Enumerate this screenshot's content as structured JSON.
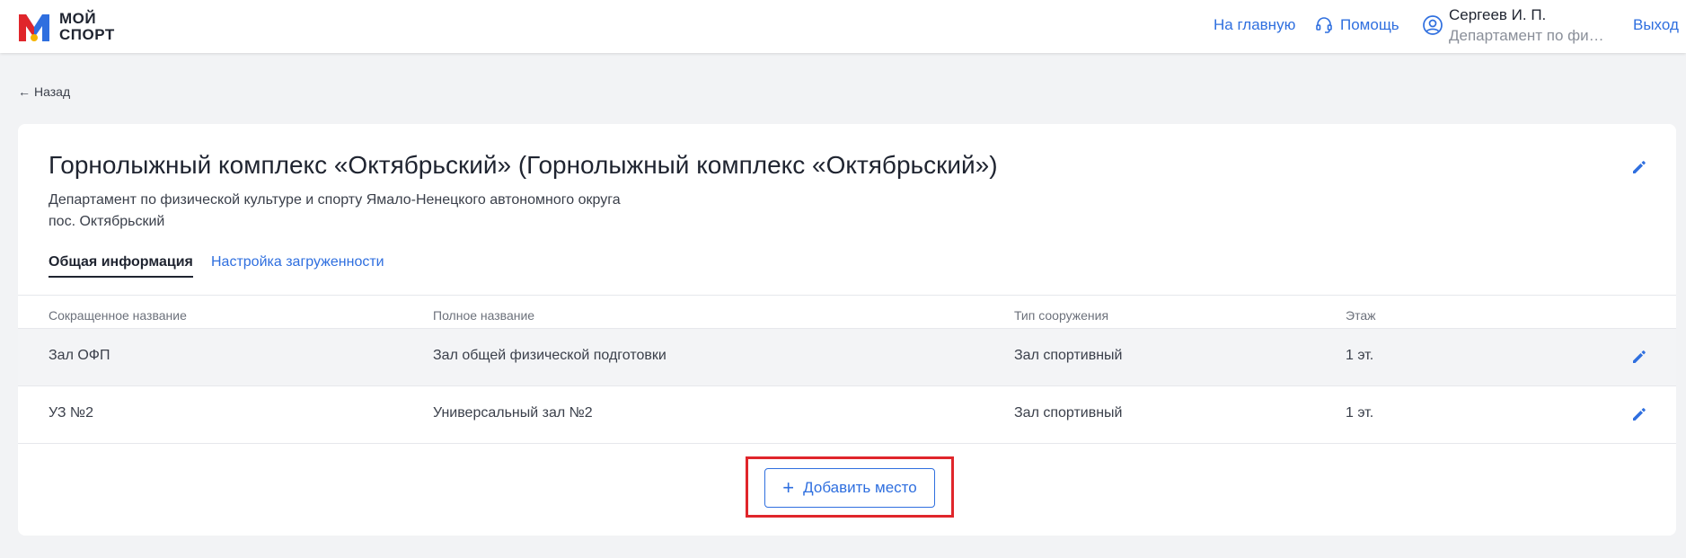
{
  "header": {
    "logo_line1": "МОЙ",
    "logo_line2": "СПОРТ",
    "home_label": "На главную",
    "help_label": "Помощь",
    "user_name": "Сергеев И. П.",
    "user_dept": "Департамент по физ...",
    "exit_label": "Выход"
  },
  "back_label": "Назад",
  "facility": {
    "title": "Горнолыжный комплекс «Октябрьский» (Горнолыжный комплекс «Октябрьский»)",
    "department": "Департамент по физической культуре и спорту Ямало-Ненецкого автономного округа",
    "locality": "пос. Октябрьский"
  },
  "tabs": [
    {
      "label": "Общая информация",
      "active": true
    },
    {
      "label": "Настройка загруженности",
      "active": false
    }
  ],
  "table": {
    "columns": [
      "Сокращенное название",
      "Полное название",
      "Тип сооружения",
      "Этаж"
    ],
    "rows": [
      [
        "Зал ОФП",
        "Зал общей физической подготовки",
        "Зал спортивный",
        "1 эт."
      ],
      [
        "УЗ №2",
        "Универсальный зал №2",
        "Зал спортивный",
        "1 эт."
      ]
    ]
  },
  "add_button_label": "Добавить место",
  "icons": {
    "logo": "moy-sport-logo",
    "help": "headset-icon",
    "user": "user-circle-icon",
    "edit": "pencil-icon",
    "back": "arrow-left-icon",
    "add": "plus-icon"
  },
  "colors": {
    "accent": "#2f6fdf",
    "highlight": "#e0262b",
    "background": "#f2f3f5"
  }
}
